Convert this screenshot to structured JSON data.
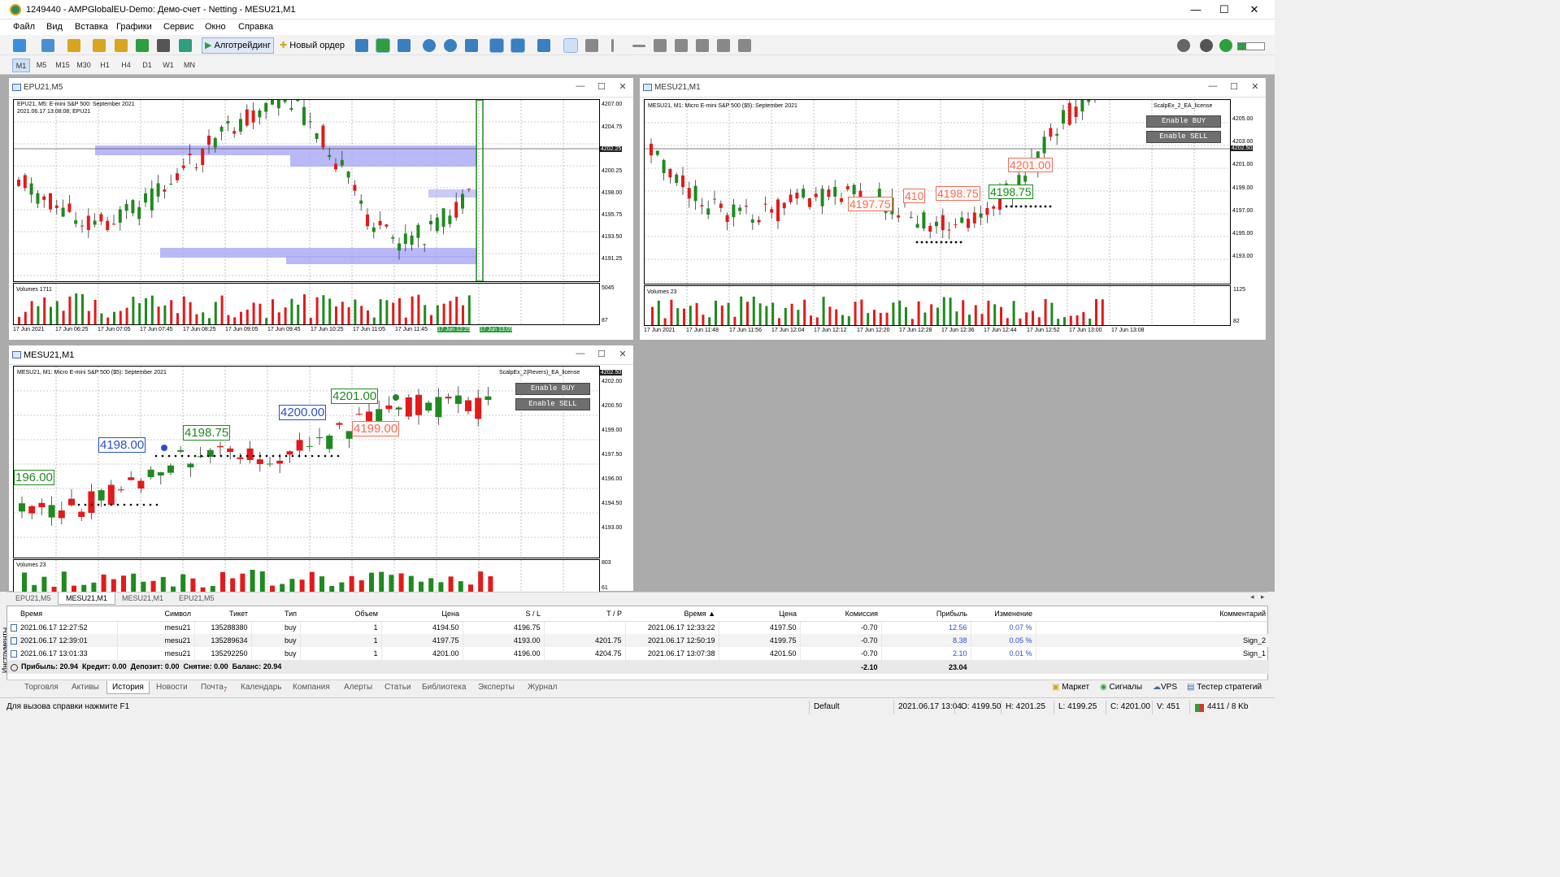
{
  "titlebar": {
    "title": "1249440 - AMPGlobalEU-Demo: Демо-счет - Netting - MESU21,M1",
    "min": "—",
    "max": "☐",
    "close": "✕"
  },
  "menu": [
    "Файл",
    "Вид",
    "Вставка",
    "Графики",
    "Сервис",
    "Окно",
    "Справка"
  ],
  "toolbar": {
    "algo_label": "Алготрейдинг",
    "new_order_label": "Новый ордер"
  },
  "timeframes": [
    "M1",
    "M5",
    "M15",
    "M30",
    "H1",
    "H4",
    "D1",
    "W1",
    "MN"
  ],
  "active_timeframe": "M1",
  "charts": {
    "top_left": {
      "window_title": "EPU21,M5",
      "info_line1": "EPU21, M5: E-mini S&P 500: September 2021",
      "info_line2": "2021.06.17 13:08:08; EPU21",
      "price_labels": [
        "4207.00",
        "4204.75",
        "4202.25",
        "4200.25",
        "4198.00",
        "4195.75",
        "4193.50",
        "4191.25"
      ],
      "current_price": "4202.25",
      "volumes_label": "Volumes 1711",
      "volume_labels": [
        "5045",
        "87"
      ],
      "time_labels": [
        "17 Jun 2021",
        "17 Jun 06:25",
        "17 Jun 07:05",
        "17 Jun 07:45",
        "17 Jun 08:25",
        "17 Jun 09:05",
        "17 Jun 09:45",
        "17 Jun 10:25",
        "17 Jun 11:05",
        "17 Jun 11:45",
        "17 Jun 12:25",
        "17 Jun 13:05"
      ]
    },
    "top_right": {
      "window_title": "MESU21,M1",
      "info_line1": "MESU21, M1: Micro E-mini S&P 500 ($5): September 2021",
      "ea_label": "ScalpEx_2_EA_license",
      "enable_buy": "Enable BUY",
      "enable_sell": "Enable SELL",
      "price_labels": [
        "4205.00",
        "4203.00",
        "4201.00",
        "4199.00",
        "4197.00",
        "4195.00",
        "4193.00"
      ],
      "current_price": "4202.50",
      "annotations": [
        "4197.75",
        "4198.75",
        "4201.00",
        "4198.75",
        "410"
      ],
      "volumes_label": "Volumes 23",
      "volume_labels": [
        "1125",
        "82"
      ],
      "time_labels": [
        "17 Jun 2021",
        "17 Jun 11:48",
        "17 Jun 11:56",
        "17 Jun 12:04",
        "17 Jun 12:12",
        "17 Jun 12:20",
        "17 Jun 12:28",
        "17 Jun 12:36",
        "17 Jun 12:44",
        "17 Jun 12:52",
        "17 Jun 13:00",
        "17 Jun 13:08"
      ]
    },
    "bottom_left": {
      "window_title": "MESU21,M1",
      "info_line1": "MESU21, M1: Micro E-mini S&P 500 ($5): September 2021",
      "ea_label": "ScalpEx_2(Revers)_EA_license",
      "enable_buy": "Enable BUY",
      "enable_sell": "Enable SELL",
      "price_labels": [
        "4202.00",
        "4200.50",
        "4199.00",
        "4197.50",
        "4196.00",
        "4194.50",
        "4193.00"
      ],
      "current_price": "4202.50",
      "annotations": [
        "196.00",
        "4198.00",
        "4198.75",
        "4200.00",
        "4201.00",
        "4199.00"
      ],
      "volumes_label": "Volumes 23",
      "volume_labels": [
        "803",
        "61"
      ]
    }
  },
  "chart_tabs": [
    "EPU21,M5",
    "MESU21,M1",
    "MESU21,M1",
    "EPU21,M5"
  ],
  "active_chart_tab": "MESU21,M1",
  "terminal": {
    "side_label": "Инструменты",
    "columns": [
      "Время",
      "Символ",
      "Тикет",
      "Тип",
      "Объем",
      "Цена",
      "S / L",
      "T / P",
      "Время",
      "Цена",
      "Комиссия",
      "Прибыль",
      "Изменение",
      "Комментарий"
    ],
    "rows": [
      [
        "2021.06.17 12:27:52",
        "mesu21",
        "135288380",
        "buy",
        "1",
        "4194.50",
        "4196.75",
        "",
        "2021.06.17 12:33:22",
        "4197.50",
        "-0.70",
        "12.56",
        "0.07 %",
        ""
      ],
      [
        "2021.06.17 12:39:01",
        "mesu21",
        "135289634",
        "buy",
        "1",
        "4197.75",
        "4193.00",
        "4201.75",
        "2021.06.17 12:50:19",
        "4199.75",
        "-0.70",
        "8.38",
        "0.05 %",
        "Sign_2"
      ],
      [
        "2021.06.17 13:01:33",
        "mesu21",
        "135292250",
        "buy",
        "1",
        "4201.00",
        "4196.00",
        "4204.75",
        "2021.06.17 13:07:38",
        "4201.50",
        "-0.70",
        "2.10",
        "0.01 %",
        "Sign_1"
      ]
    ],
    "summary": "Прибыль: 20.94  Кредит: 0.00  Депозит: 0.00  Снятие: 0.00  Баланс: 20.94",
    "summary_commission": "-2.10",
    "summary_profit": "23.04"
  },
  "bottom_tabs": [
    "Торговля",
    "Активы",
    "История",
    "Новости",
    "Почта",
    "Календарь",
    "Компания",
    "Алерты",
    "Статьи",
    "Библиотека",
    "Эксперты",
    "Журнал"
  ],
  "active_bottom_tab": "История",
  "mail_badge": "7",
  "right_tabs": [
    "Маркет",
    "Сигналы",
    "VPS",
    "Тестер стратегий"
  ],
  "status": {
    "help": "Для вызова справки нажмите F1",
    "profile": "Default",
    "datetime": "2021.06.17 13:04",
    "open": "O: 4199.50",
    "high": "H: 4201.25",
    "low": "L: 4199.25",
    "close": "C: 4201.00",
    "volume": "V: 451",
    "traffic": "4411 / 8 Kb"
  },
  "colors": {
    "bull": "#1f8a1f",
    "bear": "#e31a1a",
    "zone": "#a7a7f5",
    "accent": "#2a4fcc",
    "annot_red": "#ef6f5a"
  }
}
